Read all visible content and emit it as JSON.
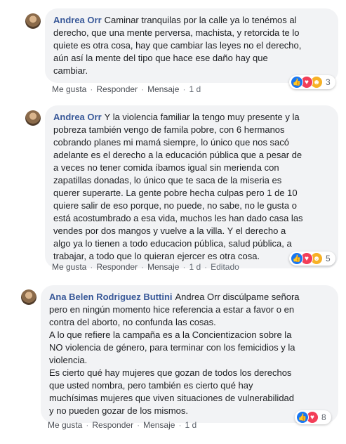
{
  "comments": [
    {
      "author": "Andrea Orr",
      "text": "Caminar tranquilas por la calle ya lo tenémos al\nderecho, que una mente perversa, machista, y retorcida te lo\nquiete es otra cosa, hay que cambiar las leyes no el derecho,\naún así la mente del tipo que hace ese daño hay que\ncambiar.",
      "actions": {
        "like": "Me gusta",
        "reply": "Responder",
        "message": "Mensaje",
        "time": "1 d"
      },
      "reactions": {
        "icons": [
          "like-icon",
          "love-icon",
          "haha-icon"
        ],
        "count": "3"
      }
    },
    {
      "author": "Andrea Orr",
      "text": "Y la violencia familiar la tengo muy presente y la\npobreza también vengo de famila pobre, con 6 hermanos\ncobrando planes mi mamá siempre, lo único que nos sacó\nadelante es el derecho a la educación pública que a pesar de\na veces no tener comida íbamos igual sin merienda con\nzapatillas donadas, lo único que te saca de la miseria es\nquerer superarte. La gente pobre hecha culpas pero 1 de 10\nquiere salir de eso porque, no puede, no sabe, no le gusta o\nestá acostumbrado a esa vida, muchos les han dado casa las\nvendes por dos mangos y vuelve a la villa. Y el derecho a\nalgo ya lo tienen a todo educacion pública, salud pública, a\ntrabajar, a todo que lo quieran ejercer es otra cosa.",
      "actions": {
        "like": "Me gusta",
        "reply": "Responder",
        "message": "Mensaje",
        "time": "1 d",
        "edited": "Editado"
      },
      "reactions": {
        "icons": [
          "like-icon",
          "love-icon",
          "haha-icon"
        ],
        "count": "5"
      }
    },
    {
      "author": "Ana Belen Rodriguez Buttini",
      "text": "Andrea Orr discúlpame señora\npero en ningún momento hice referencia a estar a favor o en\ncontra del aborto, no confunda las cosas.\nA lo que refiere la campaña es a la Concientizacion sobre la\nNO violencia de género, para terminar con los femicidios y la\nviolencia.\nEs cierto qué hay mujeres que gozan de todos los derechos\nque usted nombra, pero también es cierto qué hay\nmuchísimas mujeres que viven situaciones de vulnerabilidad\ny no pueden gozar de los mismos.",
      "actions": {
        "like": "Me gusta",
        "reply": "Responder",
        "message": "Mensaje",
        "time": "1 d"
      },
      "reactions": {
        "icons": [
          "like-icon",
          "love-icon"
        ],
        "count": "8"
      }
    }
  ],
  "colors": {
    "author": "#385898",
    "bubble": "#f2f3f5",
    "like": "#1877f2",
    "love": "#f33e58",
    "haha": "#f7b125"
  }
}
